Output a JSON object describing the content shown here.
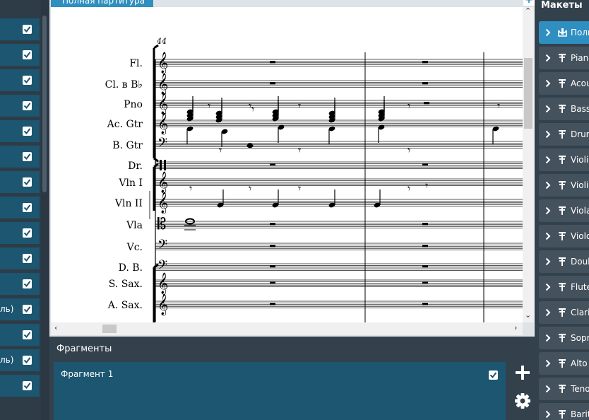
{
  "left_panel": {
    "rows": [
      {
        "text": "",
        "checked": true
      },
      {
        "text": "",
        "checked": true
      },
      {
        "text": "",
        "checked": true
      },
      {
        "text": "",
        "checked": true
      },
      {
        "text": "",
        "checked": true
      },
      {
        "text": "",
        "checked": true
      },
      {
        "text": "",
        "checked": true
      },
      {
        "text": "",
        "checked": true
      },
      {
        "text": "",
        "checked": true
      },
      {
        "text": "",
        "checked": true
      },
      {
        "text": "",
        "checked": true
      },
      {
        "text": "ль)",
        "checked": true
      },
      {
        "text": "",
        "checked": true
      },
      {
        "text": "ль)",
        "checked": true
      },
      {
        "text": "",
        "checked": true
      }
    ]
  },
  "score": {
    "tab_label": "Полная партитура",
    "add_label": "+",
    "tempo_number": "44",
    "instruments": [
      "Fl.",
      "Cl. в B♭",
      "Pno",
      "Ac. Gtr",
      "B. Gtr",
      "Dr.",
      "Vln I",
      "Vln II",
      "Vla",
      "Vc.",
      "D. B.",
      "S. Sax.",
      "A. Sax."
    ]
  },
  "fragments": {
    "title": "Фрагменты",
    "items": [
      {
        "label": "Фрагмент 1",
        "checked": true
      }
    ]
  },
  "layouts": {
    "title": "Макеты",
    "items": [
      {
        "label": "Полная партитура",
        "icon": "full-score-icon",
        "active": true
      },
      {
        "label": "Piano",
        "icon": "part-icon"
      },
      {
        "label": "Acoustic Guitar",
        "icon": "part-icon"
      },
      {
        "label": "Bass Guitar",
        "icon": "part-icon"
      },
      {
        "label": "Drum Set",
        "icon": "part-icon"
      },
      {
        "label": "Violin I",
        "icon": "part-icon"
      },
      {
        "label": "Violin II",
        "icon": "part-icon"
      },
      {
        "label": "Viola",
        "icon": "part-icon"
      },
      {
        "label": "Violoncello",
        "icon": "part-icon"
      },
      {
        "label": "Double Bass",
        "icon": "part-icon"
      },
      {
        "label": "Flute",
        "icon": "part-icon"
      },
      {
        "label": "Clarinet in B♭",
        "icon": "part-icon"
      },
      {
        "label": "Soprano Saxophone",
        "icon": "part-icon"
      },
      {
        "label": "Alto Saxophone",
        "icon": "part-icon"
      },
      {
        "label": "Tenor Saxophone",
        "icon": "part-icon"
      },
      {
        "label": "Baritone Saxophone",
        "icon": "part-icon"
      }
    ]
  },
  "colors": {
    "accent": "#2f8fc0",
    "row_bg": "#1c5670",
    "panel_bg": "#33414d",
    "item_bg": "#44525e"
  }
}
